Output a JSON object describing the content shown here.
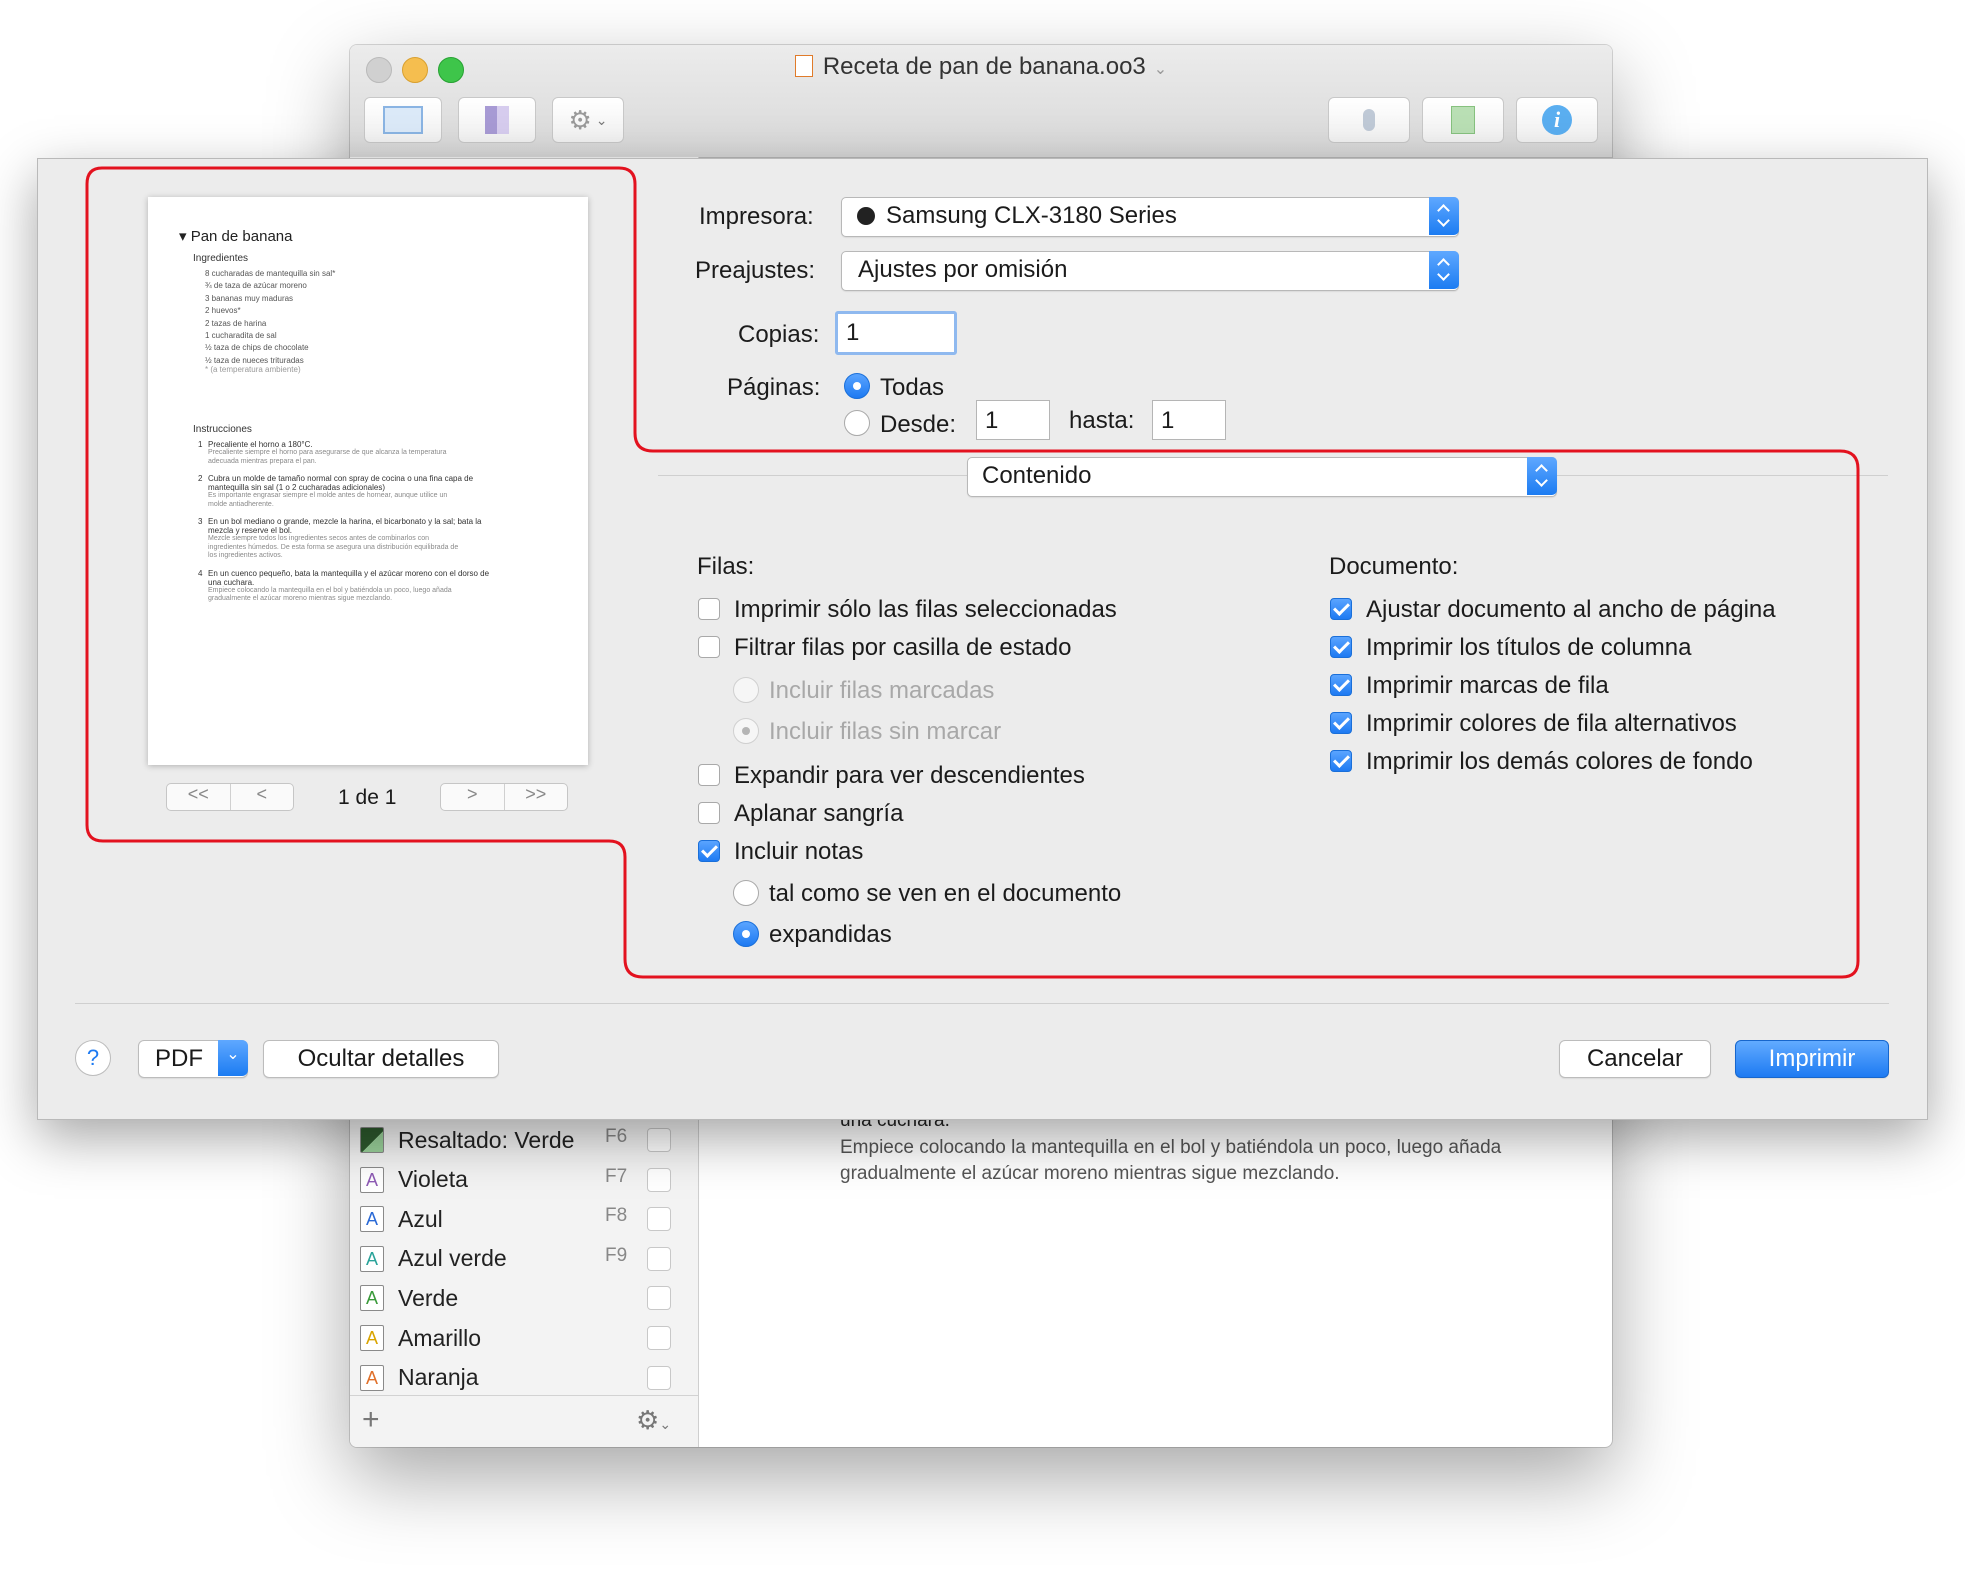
{
  "window": {
    "title": "Receta de pan de banana.oo3",
    "styles": [
      {
        "label": "Resaltado: Verde",
        "key": "F6",
        "color": "#2d5a2d"
      },
      {
        "label": "Violeta",
        "key": "F7",
        "color": "#8e5bb5"
      },
      {
        "label": "Azul",
        "key": "F8",
        "color": "#2b6ad6"
      },
      {
        "label": "Azul verde",
        "key": "F9",
        "color": "#2aa39a"
      },
      {
        "label": "Verde",
        "key": "",
        "color": "#3a9a3a"
      },
      {
        "label": "Amarillo",
        "key": "",
        "color": "#d9a400"
      },
      {
        "label": "Naranja",
        "key": "",
        "color": "#e0702a"
      }
    ],
    "body_text": {
      "line1": "una cuchara.",
      "line2": "Empiece colocando la mantequilla en el bol y batiéndola un poco, luego añada",
      "line3": "gradualmente el azúcar moreno mientras sigue mezclando."
    },
    "add_symbol": "+"
  },
  "preview": {
    "title": "Pan de banana",
    "ingredients_heading": "Ingredientes",
    "ingredients": [
      "8 cucharadas de mantequilla sin sal*",
      "¾ de taza de azúcar moreno",
      "3 bananas muy maduras",
      "2 huevos*",
      "2 tazas de harina",
      "1 cucharadita de sal",
      "½ taza de chips de chocolate",
      "½ taza de nueces trituradas",
      "* (a temperatura ambiente)"
    ],
    "instructions_heading": "Instrucciones",
    "instructions": [
      {
        "n": "1",
        "text": "Precaliente el horno a 180°C.",
        "note": [
          "Precaliente siempre el horno para asegurarse de que alcanza la temperatura",
          "adecuada mientras prepara el pan."
        ]
      },
      {
        "n": "2",
        "text": "Cubra un molde de tamaño normal con spray de cocina o una fina capa de",
        "text2": "mantequilla sin sal (1 o 2 cucharadas adicionales)",
        "note": [
          "Es importante engrasar siempre el molde antes de hornear, aunque utilice un",
          "molde antiadherente."
        ]
      },
      {
        "n": "3",
        "text": "En un bol mediano o grande, mezcle la harina, el bicarbonato y la sal; bata la",
        "text2": "mezcla y reserve el bol.",
        "note": [
          "Mezcle siempre todos los ingredientes secos antes de combinarlos con",
          "ingredientes húmedos. De esta forma se asegura una distribución equilibrada de",
          "los ingredientes activos."
        ]
      },
      {
        "n": "4",
        "text": "En un cuenco pequeño, bata la mantequilla y el azúcar moreno con el dorso de",
        "text2": "una cuchara.",
        "note": [
          "Empiece colocando la mantequilla en el bol y batiéndola un poco, luego añada",
          "gradualmente el azúcar moreno mientras sigue mezclando."
        ]
      }
    ],
    "first": "<<",
    "prev": "<",
    "page_label": "1 de 1",
    "next": ">",
    "last": ">>"
  },
  "printer": {
    "printer_label": "Impresora:",
    "printer_value": "Samsung CLX-3180 Series",
    "presets_label": "Preajustes:",
    "presets_value": "Ajustes por omisión",
    "copies_label": "Copias:",
    "copies_value": "1",
    "pages_label": "Páginas:",
    "all_label": "Todas",
    "from_label": "Desde:",
    "from_value": "1",
    "to_label": "hasta:",
    "to_value": "1"
  },
  "section_popup": "Contenido",
  "rows": {
    "heading": "Filas:",
    "only_selected": "Imprimir sólo las filas seleccionadas",
    "filter_status": "Filtrar filas por casilla de estado",
    "include_checked": "Incluir filas marcadas",
    "include_unchecked": "Incluir filas sin marcar",
    "expand_desc": "Expandir para ver descendientes",
    "flatten_indent": "Aplanar sangría",
    "include_notes": "Incluir notas",
    "as_shown": "tal como se ven en el documento",
    "expanded": "expandidas"
  },
  "document": {
    "heading": "Documento:",
    "fit_width": "Ajustar documento al ancho de página",
    "col_titles": "Imprimir los títulos de columna",
    "row_marks": "Imprimir marcas de fila",
    "alt_colors": "Imprimir colores de fila alternativos",
    "bg_colors": "Imprimir los demás colores de fondo"
  },
  "footer": {
    "help": "?",
    "pdf": "PDF",
    "hide_details": "Ocultar detalles",
    "cancel": "Cancelar",
    "print": "Imprimir"
  },
  "colors": {
    "accent": "#1d7af2",
    "highlight": "#e3121f"
  }
}
